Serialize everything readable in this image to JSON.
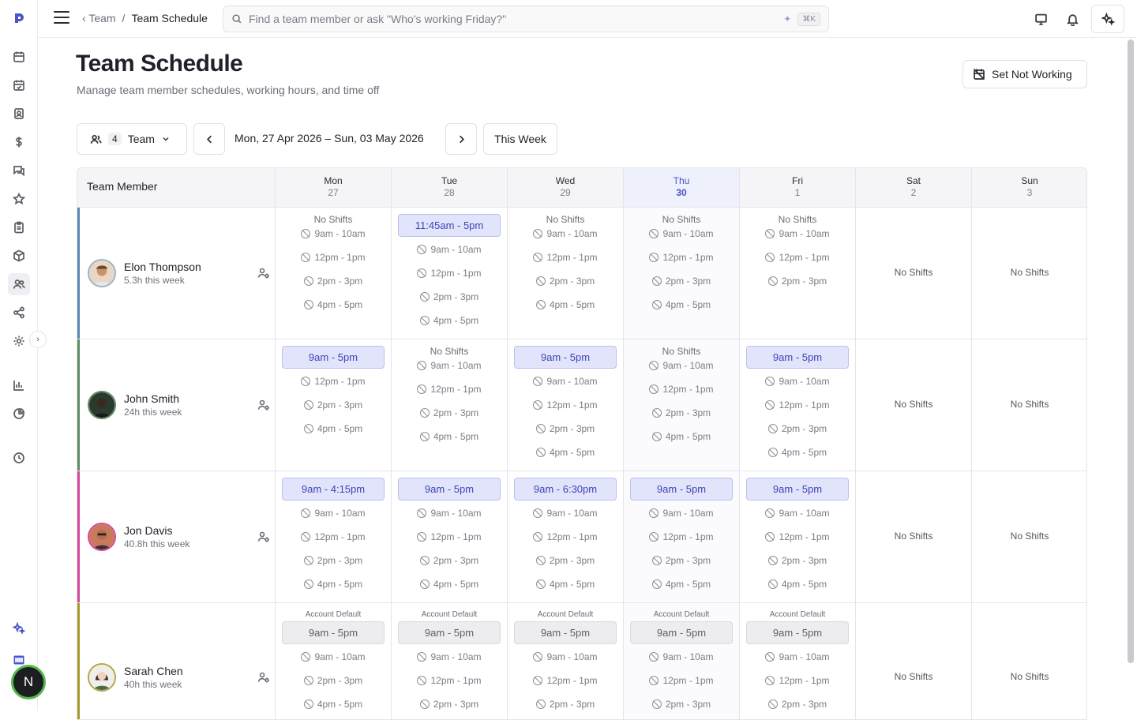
{
  "app": {
    "accent": "#4a55c9"
  },
  "rail": {
    "icons": [
      "logo-icon",
      "calendar-icon",
      "calendar-check-icon",
      "contact-icon",
      "dollar-icon",
      "chat-icon",
      "star-icon",
      "clipboard-icon",
      "package-icon",
      "team-icon",
      "share-icon",
      "settings-icon",
      "chart-bar-icon",
      "pie-chart-icon",
      "clock-icon",
      "sparkle-icon",
      "barcode-icon"
    ],
    "expand_glyph": "›",
    "avatar_initial": "N"
  },
  "topbar": {
    "breadcrumb_back": "Team",
    "breadcrumb_sep": "/",
    "breadcrumb_current": "Team Schedule",
    "search_placeholder": "Find a team member or ask \"Who's working Friday?\"",
    "search_shortcut": "⌘K"
  },
  "header": {
    "title": "Team Schedule",
    "subtitle": "Manage team member schedules, working hours, and time off",
    "set_not_working": "Set Not Working"
  },
  "toolbar": {
    "team_count": "4",
    "team_label": "Team",
    "date_range": "Mon, 27 Apr 2026 – Sun, 03 May 2026",
    "this_week": "This Week"
  },
  "grid": {
    "member_header": "Team Member",
    "days": [
      {
        "name": "Mon",
        "date": "27",
        "today": false
      },
      {
        "name": "Tue",
        "date": "28",
        "today": false
      },
      {
        "name": "Wed",
        "date": "29",
        "today": false
      },
      {
        "name": "Thu",
        "date": "30",
        "today": true
      },
      {
        "name": "Fri",
        "date": "1",
        "today": false
      },
      {
        "name": "Sat",
        "date": "2",
        "today": false
      },
      {
        "name": "Sun",
        "date": "3",
        "today": false
      }
    ],
    "no_shifts": "No Shifts",
    "account_default": "Account Default",
    "members": [
      {
        "name": "Elon Thompson",
        "hours": "5.3h this week",
        "color": "#5b87b5",
        "days": [
          {
            "top": "No Shifts",
            "shift": null,
            "slots": [
              "9am - 10am",
              "12pm - 1pm",
              "2pm - 3pm",
              "4pm - 5pm"
            ]
          },
          {
            "top": null,
            "shift": "11:45am - 5pm",
            "slots": [
              "9am - 10am",
              "12pm - 1pm",
              "2pm - 3pm",
              "4pm - 5pm"
            ]
          },
          {
            "top": "No Shifts",
            "shift": null,
            "slots": [
              "9am - 10am",
              "12pm - 1pm",
              "2pm - 3pm",
              "4pm - 5pm"
            ]
          },
          {
            "top": "No Shifts",
            "shift": null,
            "slots": [
              "9am - 10am",
              "12pm - 1pm",
              "2pm - 3pm",
              "4pm - 5pm"
            ]
          },
          {
            "top": "No Shifts",
            "shift": null,
            "slots": [
              "9am - 10am",
              "12pm - 1pm",
              "2pm - 3pm"
            ]
          },
          {
            "empty": true
          },
          {
            "empty": true
          }
        ]
      },
      {
        "name": "John Smith",
        "hours": "24h this week",
        "color": "#5f8a62",
        "days": [
          {
            "top": null,
            "shift": "9am - 5pm",
            "slots": [
              "12pm - 1pm",
              "2pm - 3pm",
              "4pm - 5pm"
            ]
          },
          {
            "top": "No Shifts",
            "shift": null,
            "slots": [
              "9am - 10am",
              "12pm - 1pm",
              "2pm - 3pm",
              "4pm - 5pm"
            ]
          },
          {
            "top": null,
            "shift": "9am - 5pm",
            "slots": [
              "9am - 10am",
              "12pm - 1pm",
              "2pm - 3pm",
              "4pm - 5pm"
            ]
          },
          {
            "top": "No Shifts",
            "shift": null,
            "slots": [
              "9am - 10am",
              "12pm - 1pm",
              "2pm - 3pm",
              "4pm - 5pm"
            ]
          },
          {
            "top": null,
            "shift": "9am - 5pm",
            "slots": [
              "9am - 10am",
              "12pm - 1pm",
              "2pm - 3pm",
              "4pm - 5pm"
            ]
          },
          {
            "empty": true
          },
          {
            "empty": true
          }
        ]
      },
      {
        "name": "Jon Davis",
        "hours": "40.8h this week",
        "color": "#d64a9c",
        "days": [
          {
            "top": null,
            "shift": "9am - 4:15pm",
            "slots": [
              "9am - 10am",
              "12pm - 1pm",
              "2pm - 3pm",
              "4pm - 5pm"
            ]
          },
          {
            "top": null,
            "shift": "9am - 5pm",
            "slots": [
              "9am - 10am",
              "12pm - 1pm",
              "2pm - 3pm",
              "4pm - 5pm"
            ]
          },
          {
            "top": null,
            "shift": "9am - 6:30pm",
            "slots": [
              "9am - 10am",
              "12pm - 1pm",
              "2pm - 3pm",
              "4pm - 5pm"
            ]
          },
          {
            "top": null,
            "shift": "9am - 5pm",
            "slots": [
              "9am - 10am",
              "12pm - 1pm",
              "2pm - 3pm",
              "4pm - 5pm"
            ]
          },
          {
            "top": null,
            "shift": "9am - 5pm",
            "slots": [
              "9am - 10am",
              "12pm - 1pm",
              "2pm - 3pm",
              "4pm - 5pm"
            ]
          },
          {
            "empty": true
          },
          {
            "empty": true
          }
        ]
      },
      {
        "name": "Sarah Chen",
        "hours": "40h this week",
        "color": "#a89a2a",
        "days": [
          {
            "top": "Account Default",
            "default_shift": "9am - 5pm",
            "slots": [
              "9am - 10am",
              "2pm - 3pm",
              "4pm - 5pm"
            ]
          },
          {
            "top": "Account Default",
            "default_shift": "9am - 5pm",
            "slots": [
              "9am - 10am",
              "12pm - 1pm",
              "2pm - 3pm"
            ]
          },
          {
            "top": "Account Default",
            "default_shift": "9am - 5pm",
            "slots": [
              "9am - 10am",
              "12pm - 1pm",
              "2pm - 3pm"
            ]
          },
          {
            "top": "Account Default",
            "default_shift": "9am - 5pm",
            "slots": [
              "9am - 10am",
              "12pm - 1pm",
              "2pm - 3pm"
            ]
          },
          {
            "top": "Account Default",
            "default_shift": "9am - 5pm",
            "slots": [
              "9am - 10am",
              "12pm - 1pm",
              "2pm - 3pm"
            ]
          },
          {
            "empty": true
          },
          {
            "empty": true
          }
        ]
      }
    ]
  }
}
